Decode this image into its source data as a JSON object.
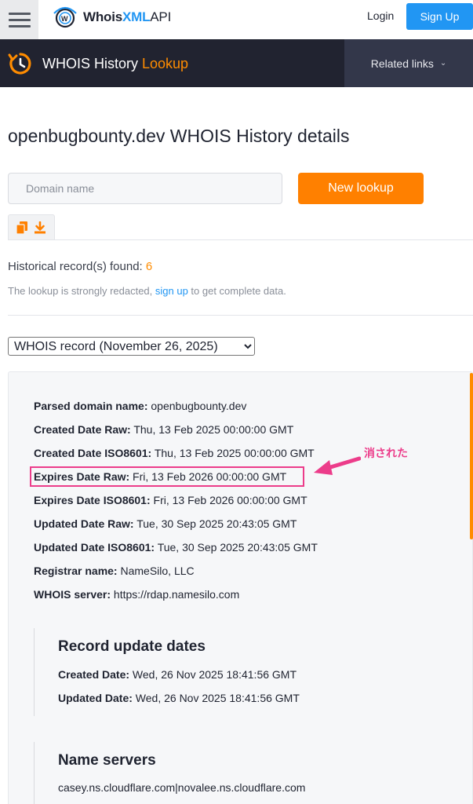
{
  "header": {
    "brand_prefix": "Whois",
    "brand_xml": "XML",
    "brand_api": "API",
    "login_label": "Login",
    "signup_label": "Sign Up"
  },
  "banner": {
    "title_main": "WHOIS History ",
    "title_accent": "Lookup",
    "related_label": "Related links"
  },
  "page": {
    "title": "openbugbounty.dev WHOIS History details",
    "search_placeholder": "Domain name",
    "new_lookup_label": "New lookup",
    "found_label": "Historical record(s) found: ",
    "found_count": "6",
    "redacted_before": "The lookup is strongly redacted, ",
    "redacted_link": "sign up",
    "redacted_after": " to get complete data.",
    "record_option": "WHOIS record (November 26, 2025)"
  },
  "record": {
    "fields": [
      {
        "key": "Parsed domain name:",
        "value": " openbugbounty.dev"
      },
      {
        "key": "Created Date Raw:",
        "value": " Thu, 13 Feb 2025 00:00:00 GMT"
      },
      {
        "key": "Created Date ISO8601:",
        "value": " Thu, 13 Feb 2025 00:00:00 GMT"
      },
      {
        "key": "Expires Date Raw:",
        "value": " Fri, 13 Feb 2026 00:00:00 GMT"
      },
      {
        "key": "Expires Date ISO8601:",
        "value": " Fri, 13 Feb 2026 00:00:00 GMT"
      },
      {
        "key": "Updated Date Raw:",
        "value": " Tue, 30 Sep 2025 20:43:05 GMT"
      },
      {
        "key": "Updated Date ISO8601:",
        "value": " Tue, 30 Sep 2025 20:43:05 GMT"
      },
      {
        "key": "Registrar name:",
        "value": " NameSilo, LLC"
      },
      {
        "key": "WHOIS server:",
        "value": " https://rdap.namesilo.com"
      }
    ],
    "update_dates": {
      "title": "Record update dates",
      "created_key": "Created Date:",
      "created_value": " Wed, 26 Nov 2025 18:41:56 GMT",
      "updated_key": "Updated Date:",
      "updated_value": " Wed, 26 Nov 2025 18:41:56 GMT"
    },
    "name_servers": {
      "title": "Name servers",
      "value": "casey.ns.cloudflare.com|novalee.ns.cloudflare.com"
    }
  },
  "annotation": {
    "text": "消された",
    "color": "#ec3c8a"
  },
  "colors": {
    "accent_orange": "#ff8000",
    "brand_blue": "#2196f3",
    "banner_dark": "#212330"
  }
}
